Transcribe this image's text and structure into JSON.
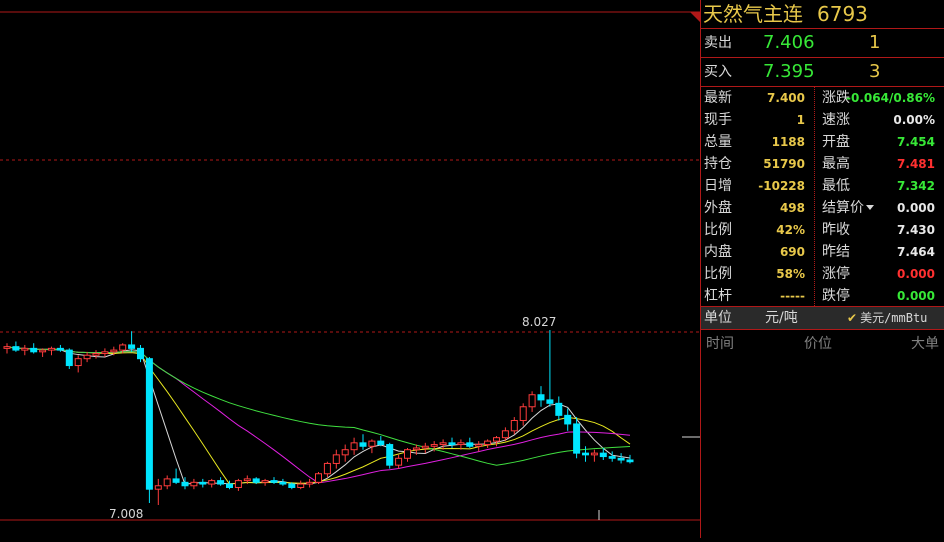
{
  "instrument": {
    "name": "天然气主连",
    "code": "6793"
  },
  "quote": {
    "sell": {
      "label": "卖出",
      "price": "7.406",
      "volume": "1"
    },
    "buy": {
      "label": "买入",
      "price": "7.395",
      "volume": "3"
    }
  },
  "stats": [
    {
      "l1": "最新",
      "v1": "7.400",
      "c1": "yellow",
      "l2": "涨跌",
      "v2": "-0.064/0.86%",
      "c2": "green"
    },
    {
      "l1": "现手",
      "v1": "1",
      "c1": "yellow",
      "l2": "速涨",
      "v2": "0.00%",
      "c2": "white"
    },
    {
      "l1": "总量",
      "v1": "1188",
      "c1": "yellow",
      "l2": "开盘",
      "v2": "7.454",
      "c2": "green"
    },
    {
      "l1": "持仓",
      "v1": "51790",
      "c1": "yellow",
      "l2": "最高",
      "v2": "7.481",
      "c2": "red"
    },
    {
      "l1": "日增",
      "v1": "-10228",
      "c1": "yellow",
      "l2": "最低",
      "v2": "7.342",
      "c2": "green"
    },
    {
      "l1": "外盘",
      "v1": "498",
      "c1": "yellow",
      "l2": "结算价",
      "v2": "0.000",
      "c2": "white",
      "dropdown": true
    },
    {
      "l1": "比例",
      "v1": "42%",
      "c1": "yellow",
      "l2": "昨收",
      "v2": "7.430",
      "c2": "white"
    },
    {
      "l1": "内盘",
      "v1": "690",
      "c1": "yellow",
      "l2": "昨结",
      "v2": "7.464",
      "c2": "white"
    },
    {
      "l1": "比例",
      "v1": "58%",
      "c1": "yellow",
      "l2": "涨停",
      "v2": "0.000",
      "c2": "red"
    },
    {
      "l1": "杠杆",
      "v1": "-----",
      "c1": "yellow",
      "l2": "跌停",
      "v2": "0.000",
      "c2": "green"
    }
  ],
  "unit_bar": {
    "label": "单位",
    "unit": "元/吨",
    "usd_unit": "美元/mmBtu"
  },
  "tick_table": {
    "time": "时间",
    "price": "价位",
    "big": "大单"
  },
  "chart_data": {
    "type": "candlestick",
    "annotations": {
      "high": "8.027",
      "low": "7.008"
    },
    "colors": {
      "up": "#ff3c3c",
      "down": "#00e5ff",
      "ma_white": "#d8d8d8",
      "ma_yellow": "#e8e820",
      "ma_magenta": "#e020e0",
      "ma_green": "#40e040"
    }
  }
}
